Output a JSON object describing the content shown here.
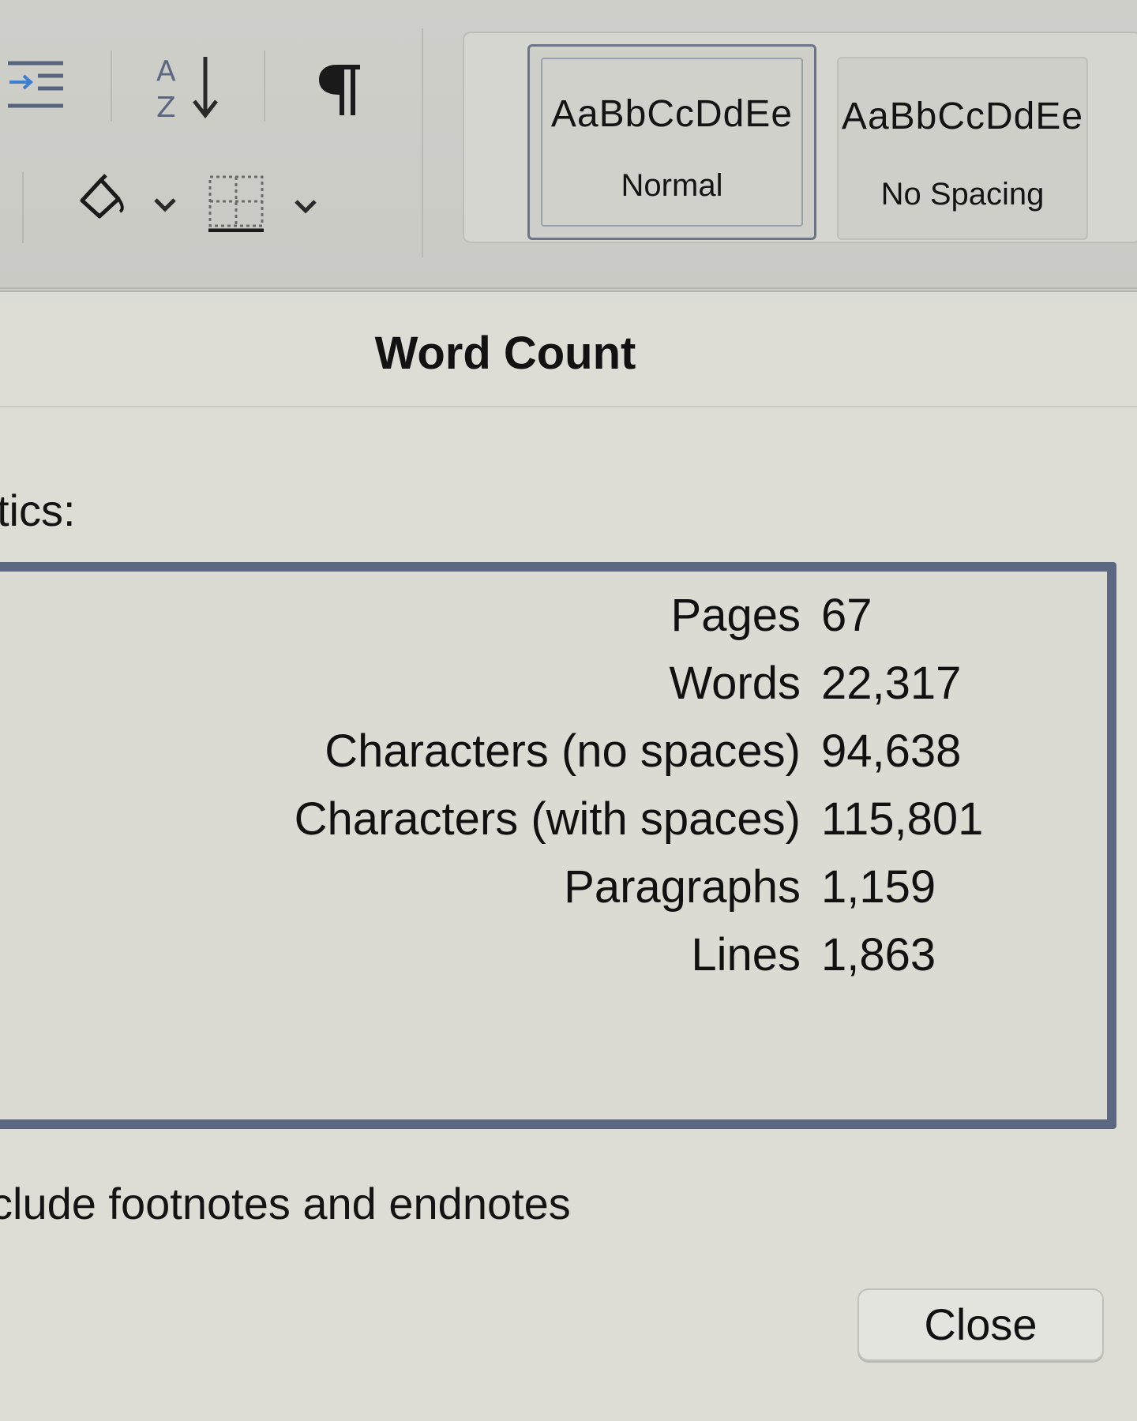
{
  "ribbon": {
    "icons": [
      "increase-indent-icon",
      "sort-az-icon",
      "pilcrow-icon",
      "paint-bucket-icon",
      "chevron-down-icon",
      "borders-icon",
      "chevron-down-icon"
    ],
    "styles": [
      {
        "sample": "AaBbCcDdEe",
        "name": "Normal",
        "selected": true
      },
      {
        "sample": "AaBbCcDdEe",
        "name": "No Spacing",
        "selected": false
      }
    ]
  },
  "dialog": {
    "title": "Word Count",
    "stats_label": "tics:",
    "stats": [
      {
        "label": "Pages",
        "value": "67"
      },
      {
        "label": "Words",
        "value": "22,317"
      },
      {
        "label": "Characters (no spaces)",
        "value": "94,638"
      },
      {
        "label": "Characters (with spaces)",
        "value": "115,801"
      },
      {
        "label": "Paragraphs",
        "value": "1,159"
      },
      {
        "label": "Lines",
        "value": "1,863"
      }
    ],
    "footnotes_label": "clude footnotes and endnotes",
    "close_label": "Close"
  },
  "colors": {
    "stats_border": "#5c6781",
    "selected_style_border": "#6b7587",
    "background": "#dcdcd6"
  }
}
